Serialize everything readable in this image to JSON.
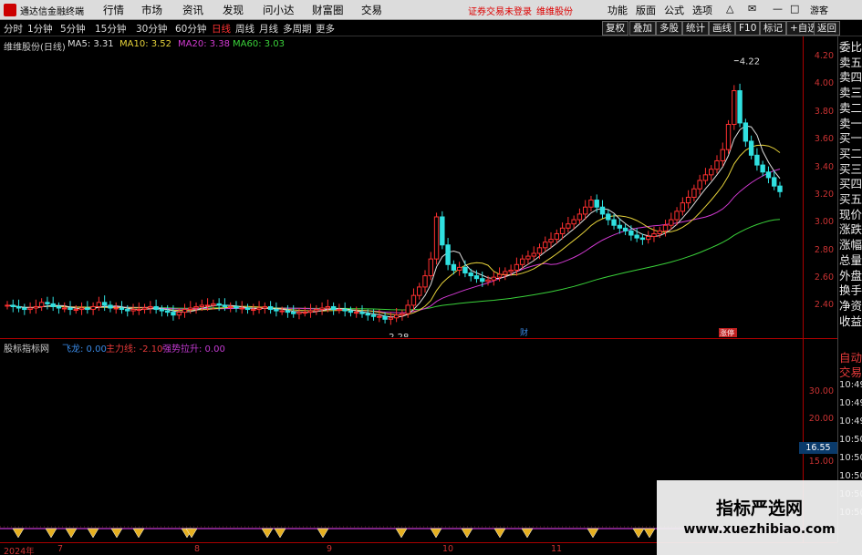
{
  "app": {
    "title": "通达信金融终端"
  },
  "menu": [
    "行情",
    "市场",
    "资讯",
    "发现",
    "问小达",
    "财富圈",
    "交易"
  ],
  "alert": "证券交易未登录",
  "alert_stock": "维维股份",
  "top_right": [
    "功能",
    "版面",
    "公式",
    "选项"
  ],
  "guest": "游客",
  "timeframes": [
    "分时",
    "1分钟",
    "5分钟",
    "15分钟",
    "30分钟",
    "60分钟",
    "日线",
    "周线",
    "月线",
    "多周期",
    "更多"
  ],
  "active_timeframe": "日线",
  "toolbar_right": [
    "复权",
    "叠加",
    "多股",
    "统计",
    "画线",
    "F10",
    "标记",
    "+自选",
    "返回"
  ],
  "stock": {
    "name": "维维股份(日线)",
    "ma": [
      {
        "label": "MA5: 3.31",
        "color": "#dddddd"
      },
      {
        "label": "MA10: 3.52",
        "color": "#e6d23a"
      },
      {
        "label": "MA20: 3.38",
        "color": "#d23ad2"
      },
      {
        "label": "MA60: 3.03",
        "color": "#3ad23a"
      }
    ],
    "high_label": "4.22",
    "low_label": "2.28",
    "markers": [
      "财",
      "涨停"
    ]
  },
  "price_axis": [
    "4.20",
    "4.00",
    "3.80",
    "3.60",
    "3.40",
    "3.20",
    "3.00",
    "2.80",
    "2.60",
    "2.40"
  ],
  "right_panel": [
    "委比",
    "卖五",
    "卖四",
    "卖三",
    "卖二",
    "卖一",
    "买一",
    "买二",
    "买三",
    "买四",
    "买五",
    "现价",
    "涨跌",
    "涨幅",
    "总量",
    "外盘",
    "换手",
    "净资",
    "收益"
  ],
  "right_panel2": [
    "自动",
    "交易"
  ],
  "times": [
    "10:49",
    "10:49",
    "10:49",
    "10:50",
    "10:50",
    "10:50",
    "10:50",
    "10:50"
  ],
  "indicator": {
    "name": "股标指标网",
    "values": [
      {
        "label": "飞龙: 0.00",
        "color": "#3a8ae6"
      },
      {
        "label": "主力线: -2.10",
        "color": "#e63a3a"
      },
      {
        "label": "强势拉升: 0.00",
        "color": "#c33ad2"
      }
    ],
    "axis": [
      "30.00",
      "20.00",
      "15.00"
    ],
    "current": "16.55"
  },
  "dates": [
    "2024年",
    "7",
    "8",
    "9",
    "10",
    "11"
  ],
  "watermark": {
    "line1": "指标严选网",
    "line2": "www.xuezhibiao.com"
  },
  "chart_data": {
    "type": "candlestick",
    "title": "维维股份(日线)",
    "xlabel": "",
    "ylabel": "",
    "ylim": [
      2.3,
      4.25
    ],
    "high": 4.22,
    "low": 2.28,
    "ma_last": {
      "MA5": 3.31,
      "MA10": 3.52,
      "MA20": 3.38,
      "MA60": 3.03
    },
    "closes": [
      2.45,
      2.44,
      2.43,
      2.42,
      2.43,
      2.44,
      2.47,
      2.46,
      2.44,
      2.43,
      2.43,
      2.42,
      2.42,
      2.43,
      2.42,
      2.44,
      2.47,
      2.45,
      2.43,
      2.43,
      2.42,
      2.41,
      2.42,
      2.42,
      2.43,
      2.44,
      2.42,
      2.41,
      2.4,
      2.38,
      2.4,
      2.42,
      2.43,
      2.44,
      2.45,
      2.45,
      2.46,
      2.45,
      2.44,
      2.44,
      2.43,
      2.43,
      2.42,
      2.42,
      2.43,
      2.44,
      2.42,
      2.41,
      2.41,
      2.4,
      2.39,
      2.4,
      2.4,
      2.41,
      2.42,
      2.43,
      2.44,
      2.42,
      2.42,
      2.41,
      2.4,
      2.4,
      2.39,
      2.38,
      2.37,
      2.37,
      2.35,
      2.36,
      2.38,
      2.39,
      2.45,
      2.52,
      2.58,
      2.66,
      2.78,
      3.08,
      2.88,
      2.74,
      2.7,
      2.72,
      2.68,
      2.66,
      2.64,
      2.62,
      2.63,
      2.65,
      2.67,
      2.69,
      2.7,
      2.74,
      2.78,
      2.8,
      2.82,
      2.86,
      2.9,
      2.92,
      2.96,
      3.0,
      3.03,
      3.06,
      3.1,
      3.15,
      3.2,
      3.15,
      3.1,
      3.06,
      3.02,
      3.0,
      2.98,
      2.95,
      2.93,
      2.92,
      2.94,
      2.96,
      2.98,
      3.02,
      3.06,
      3.12,
      3.18,
      3.22,
      3.28,
      3.34,
      3.38,
      3.42,
      3.48,
      3.56,
      3.74,
      3.98,
      3.75,
      3.62,
      3.52,
      3.45,
      3.4,
      3.36,
      3.3,
      3.26
    ]
  }
}
